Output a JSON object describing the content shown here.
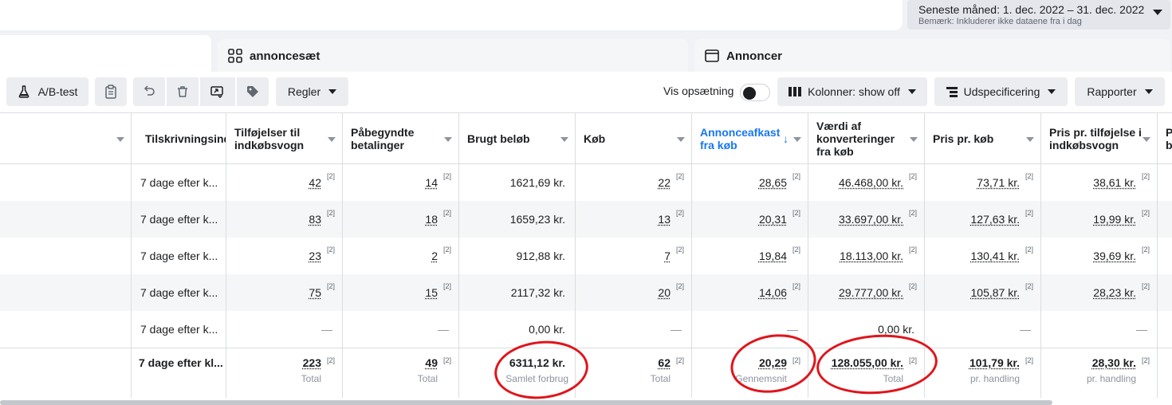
{
  "date_picker": {
    "label": "Seneste måned: 1. dec. 2022 – 31. dec. 2022",
    "note": "Bemærk: Inkluderer ikke dataene fra i dag"
  },
  "tabs": {
    "adsets": "annoncesæt",
    "ads": "Annoncer"
  },
  "toolbar": {
    "ab_test": "A/B-test",
    "rules": "Regler",
    "show_setup": "Vis opsætning",
    "columns": "Kolonner: show off",
    "breakdown": "Udspecificering",
    "reports": "Rapporter"
  },
  "table": {
    "headers": {
      "attribution": "Tilskrivningsindstilling",
      "add_to_cart": "Tilføjelser til indkøbsvogn",
      "checkouts": "Påbegyndte betalinger",
      "spent": "Brugt beløb",
      "purchases": "Køb",
      "roas": "Annonceafkast fra køb",
      "conv_value": "Værdi af konverteringer fra køb",
      "cost_per_purchase": "Pris pr. køb",
      "cost_per_atc": "Pris pr. tilføjelse i indkøbsvogn",
      "next": "P b"
    },
    "ref": "[2]",
    "dash": "—",
    "rows": [
      {
        "attribution": "7 dage efter k...",
        "add_to_cart": "42",
        "checkouts": "14",
        "spent": "1621,69 kr.",
        "purchases": "22",
        "roas": "28,65",
        "conv_value": "46.468,00 kr.",
        "cost_per_purchase": "73,71 kr.",
        "cost_per_atc": "38,61 kr."
      },
      {
        "attribution": "7 dage efter k...",
        "add_to_cart": "83",
        "checkouts": "18",
        "spent": "1659,23 kr.",
        "purchases": "13",
        "roas": "20,31",
        "conv_value": "33.697,00 kr.",
        "cost_per_purchase": "127,63 kr.",
        "cost_per_atc": "19,99 kr."
      },
      {
        "attribution": "7 dage efter k...",
        "add_to_cart": "23",
        "checkouts": "2",
        "spent": "912,88 kr.",
        "purchases": "7",
        "roas": "19,84",
        "conv_value": "18.113,00 kr.",
        "cost_per_purchase": "130,41 kr.",
        "cost_per_atc": "39,69 kr."
      },
      {
        "attribution": "7 dage efter k...",
        "add_to_cart": "75",
        "checkouts": "15",
        "spent": "2117,32 kr.",
        "purchases": "20",
        "roas": "14,06",
        "conv_value": "29.777,00 kr.",
        "cost_per_purchase": "105,87 kr.",
        "cost_per_atc": "28,23 kr."
      },
      {
        "attribution": "7 dage efter k...",
        "spent": "0,00 kr.",
        "conv_value": "0,00 kr."
      }
    ],
    "totals": {
      "attribution": "7 dage efter kl...",
      "add_to_cart": "223",
      "add_to_cart_sub": "Total",
      "checkouts": "49",
      "checkouts_sub": "Total",
      "spent": "6311,12 kr.",
      "spent_sub": "Samlet forbrug",
      "purchases": "62",
      "purchases_sub": "Total",
      "roas": "20,29",
      "roas_sub": "Gennemsnit",
      "conv_value": "128.055,00 kr.",
      "conv_value_sub": "Total",
      "cost_per_purchase": "101,79 kr.",
      "cost_per_purchase_sub": "pr. handling",
      "cost_per_atc": "28,30 kr.",
      "cost_per_atc_sub": "pr. handling"
    }
  },
  "colors": {
    "accent": "#1877f2",
    "annotation_circle": "#e0141b"
  }
}
